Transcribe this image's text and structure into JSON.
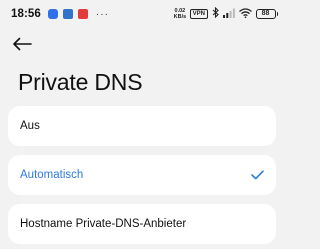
{
  "status_bar": {
    "time": "18:56",
    "more": "···",
    "net_speed_value": "0.02",
    "net_speed_unit": "KB/s",
    "vpn": "VPN",
    "battery": "88"
  },
  "header": {
    "title": "Private DNS"
  },
  "options": [
    {
      "label": "Aus",
      "selected": false
    },
    {
      "label": "Automatisch",
      "selected": true
    },
    {
      "label": "Hostname Private-DNS-Anbieter",
      "selected": false
    }
  ],
  "colors": {
    "accent": "#2f7be0",
    "background": "#f2f2f2",
    "card": "#ffffff"
  }
}
